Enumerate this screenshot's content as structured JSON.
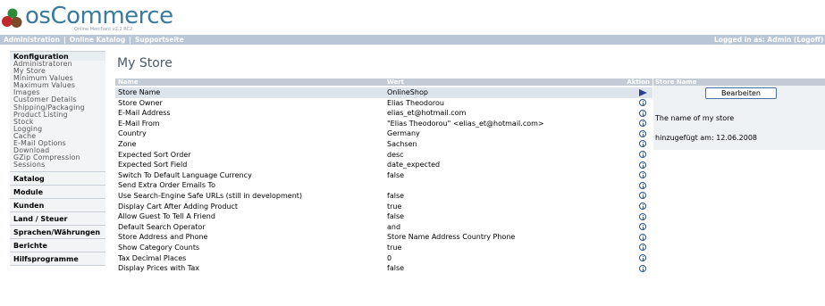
{
  "header": {
    "logo_text": "osCommerce",
    "logo_tagline": "Online Merchant v2.2 RC2"
  },
  "navbar": {
    "links": [
      "Administration",
      "Online Katalog",
      "Supportseite"
    ],
    "separator": "|",
    "logged_in": "Logged in as: Admin (Logoff)"
  },
  "sidebar": {
    "heading": "Konfiguration",
    "items": [
      "Administratoren",
      "My Store",
      "Minimum Values",
      "Maximum Values",
      "Images",
      "Customer Details",
      "Shipping/Packaging",
      "Product Listing",
      "Stock",
      "Logging",
      "Cache",
      "E-Mail Options",
      "Download",
      "GZip Compression",
      "Sessions"
    ],
    "categories": [
      "Katalog",
      "Module",
      "Kunden",
      "Land / Steuer",
      "Sprachen/Währungen",
      "Berichte",
      "Hilfsprogramme"
    ]
  },
  "main": {
    "title": "My Store",
    "columns": {
      "name": "Name",
      "value": "Wert",
      "action": "Aktion"
    },
    "rows": [
      {
        "name": "Store Name",
        "value": "OnlineShop",
        "selected": true
      },
      {
        "name": "Store Owner",
        "value": "Elias Theodorou"
      },
      {
        "name": "E-Mail Address",
        "value": "elias_et@hotmail.com"
      },
      {
        "name": "E-Mail From",
        "value": "\"Elias Theodorou\" <elias_et@hotmail.com>"
      },
      {
        "name": "Country",
        "value": "Germany"
      },
      {
        "name": "Zone",
        "value": "Sachsen"
      },
      {
        "name": "Expected Sort Order",
        "value": "desc"
      },
      {
        "name": "Expected Sort Field",
        "value": "date_expected"
      },
      {
        "name": "Switch To Default Language Currency",
        "value": "false"
      },
      {
        "name": "Send Extra Order Emails To",
        "value": ""
      },
      {
        "name": "Use Search-Engine Safe URLs (still in development)",
        "value": "false"
      },
      {
        "name": "Display Cart After Adding Product",
        "value": "true"
      },
      {
        "name": "Allow Guest To Tell A Friend",
        "value": "false"
      },
      {
        "name": "Default Search Operator",
        "value": "and"
      },
      {
        "name": "Store Address and Phone",
        "value": "Store Name Address Country Phone"
      },
      {
        "name": "Show Category Counts",
        "value": "true"
      },
      {
        "name": "Tax Decimal Places",
        "value": "0"
      },
      {
        "name": "Display Prices with Tax",
        "value": "false"
      }
    ]
  },
  "infobox": {
    "heading": "Store Name",
    "edit_label": "Bearbeiten",
    "description": "The name of my store",
    "added": "hinzugefügt am: 12.06.2008"
  },
  "colors": {
    "navbar": "#b9c6d5",
    "table_header": "#c3cbd6",
    "selected_row": "#dde4ec",
    "info_icon": "#1f4f9a",
    "arrow_icon": "#2a3f9a"
  }
}
